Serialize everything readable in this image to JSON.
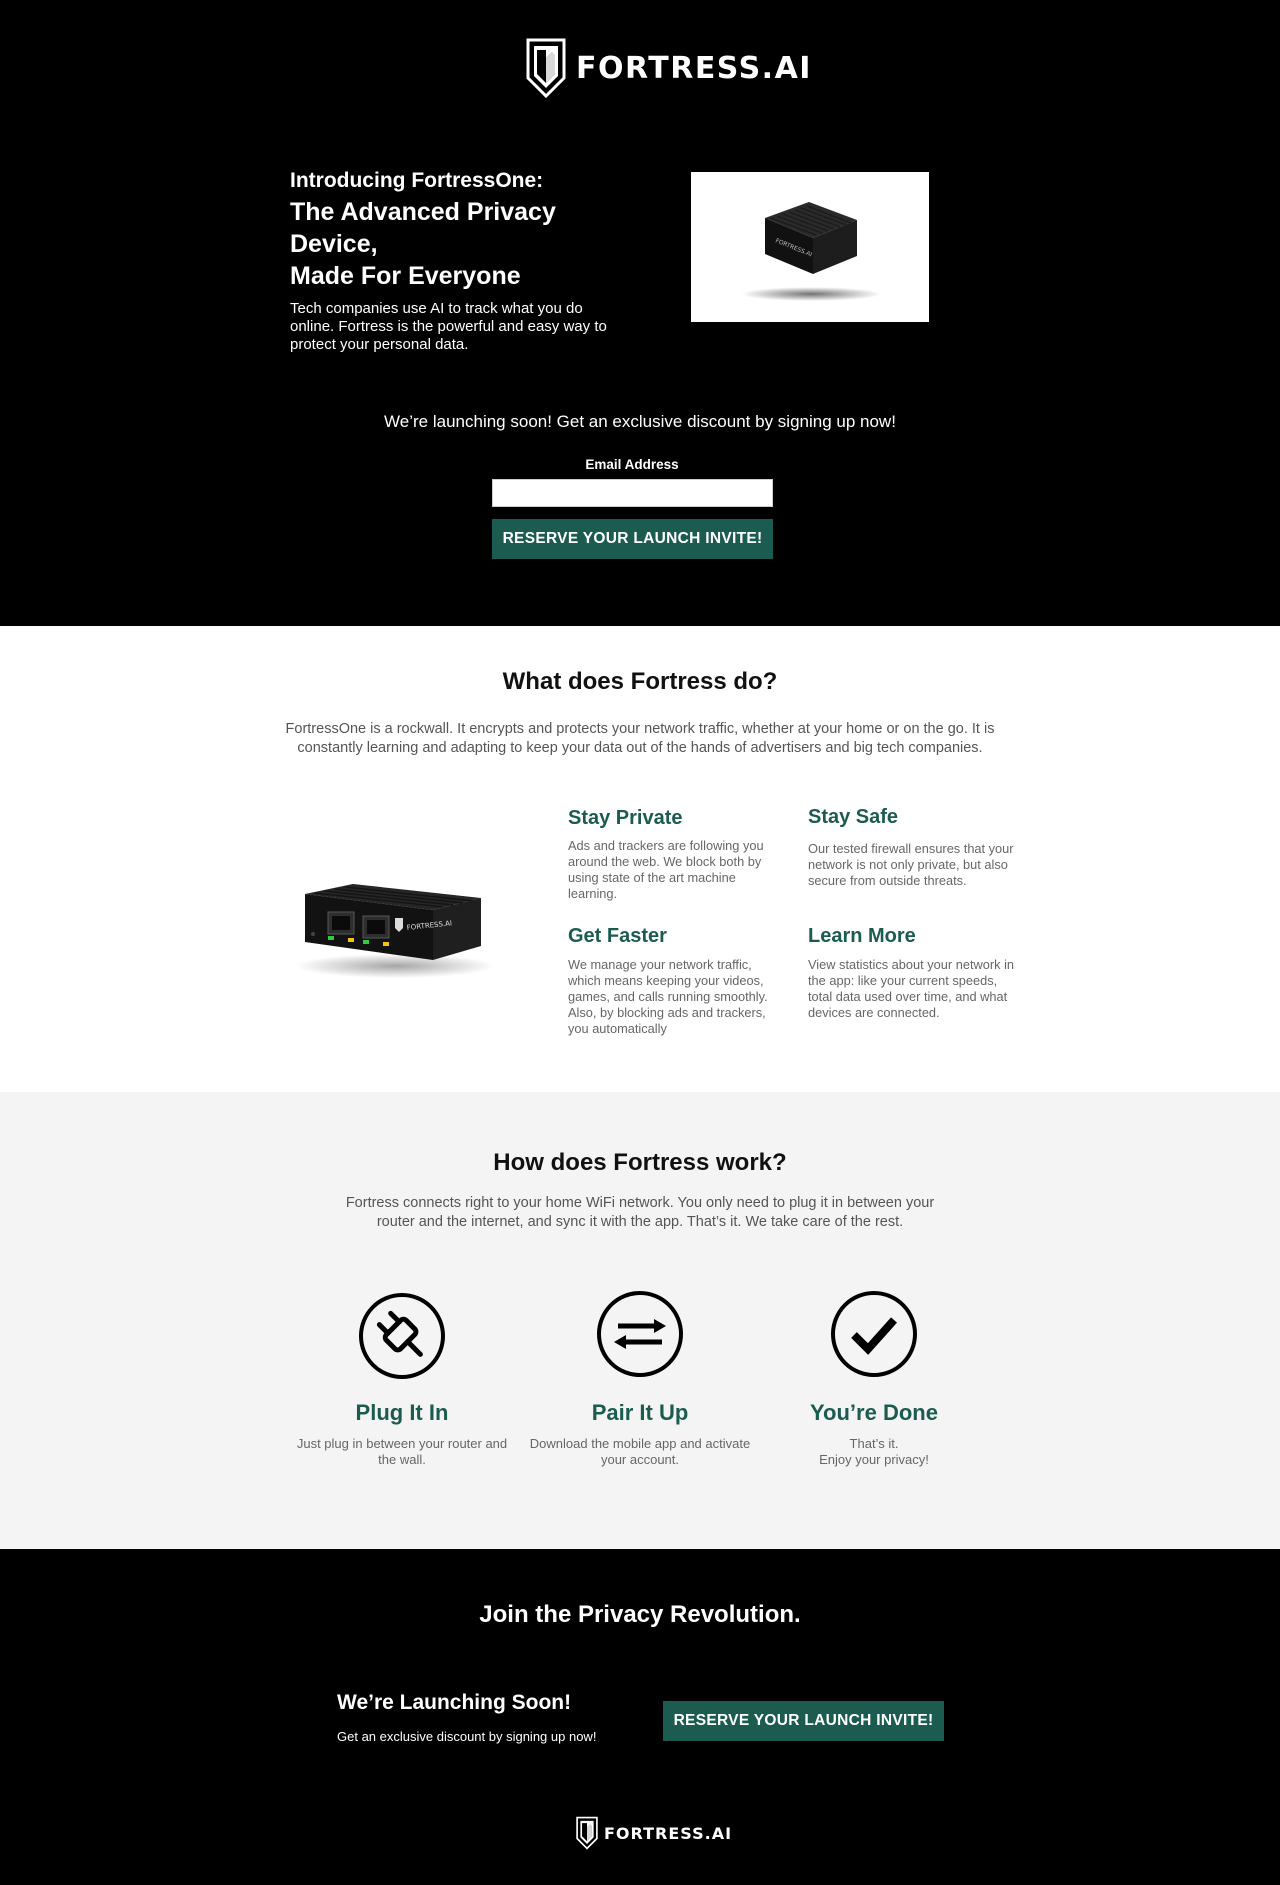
{
  "brand": {
    "name": "FORTRESS.AI"
  },
  "hero": {
    "kicker": "Introducing FortressOne:",
    "title_line1": "The Advanced Privacy Device,",
    "title_line2": "Made For Everyone",
    "description": "Tech companies use AI to track what you do online. Fortress is the powerful and easy way to protect your personal data."
  },
  "signup": {
    "tagline": "We’re launching soon! Get an exclusive discount by signing up now!",
    "email_label": "Email Address",
    "email_value": "",
    "cta_label": "RESERVE YOUR LAUNCH INVITE!"
  },
  "what": {
    "title": "What does Fortress do?",
    "description": "FortressOne is a rockwall. It encrypts and protects your network traffic, whether at your home or on the go. It is constantly learning and adapting to keep your data out of the hands of advertisers and big tech companies.",
    "features": [
      {
        "title": "Stay Private",
        "text": "Ads and trackers are following you around the web. We block both by using state of the art machine learning."
      },
      {
        "title": "Stay Safe",
        "text": "Our tested firewall ensures that your network is not only private, but also secure from outside threats."
      },
      {
        "title": "Get Faster",
        "text": "We manage your network traffic, which means keeping your videos, games, and calls running smoothly. Also, by blocking ads and trackers, you automatically"
      },
      {
        "title": "Learn More",
        "text": "View statistics about your network in the app: like your current speeds, total data used over time, and what devices are connected."
      }
    ]
  },
  "how": {
    "title": "How does Fortress work?",
    "description": "Fortress connects right to your home WiFi network. You only need to plug it in between your router and the internet, and sync it with the app. That’s it. We take care of the rest.",
    "steps": [
      {
        "icon": "plug-icon",
        "title": "Plug It In",
        "text": "Just plug in between your router and the wall."
      },
      {
        "icon": "swap-arrows-icon",
        "title": "Pair It Up",
        "text": "Download the mobile app and activate your account."
      },
      {
        "icon": "checkmark-icon",
        "title": "You’re Done",
        "text": "That’s it.\nEnjoy your privacy!"
      }
    ]
  },
  "join": {
    "title": "Join the Privacy Revolution.",
    "launch_title": "We’re Launching Soon!",
    "launch_sub": "Get an exclusive discount by signing up now!",
    "cta_label": "RESERVE YOUR LAUNCH INVITE!"
  },
  "colors": {
    "accent": "#1c5c50",
    "dark": "#000000",
    "light_section": "#f4f4f4"
  }
}
